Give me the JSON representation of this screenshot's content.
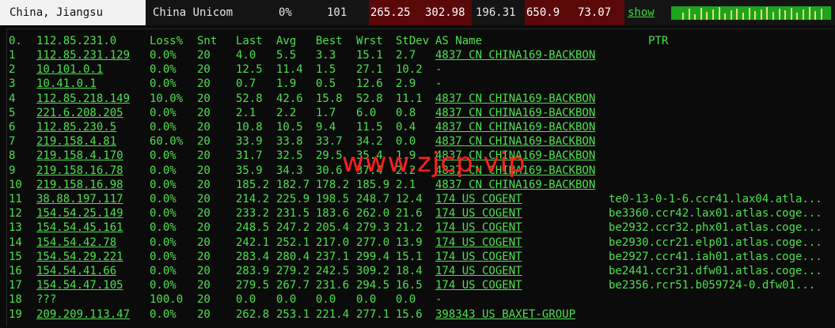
{
  "header": {
    "location": "China, Jiangsu",
    "isp": "China Unicom",
    "loss": "0%",
    "sent": "101",
    "last": "265.25",
    "avg": "302.98",
    "best": "196.31",
    "worst": "650.9",
    "stdev": "73.07",
    "show_label": "show",
    "colors": {
      "latency_bg": "#5a0808",
      "sparkline": "#1ea41e",
      "text": "#4ee04e"
    }
  },
  "columns": [
    "0.",
    "112.85.231.0",
    "Loss%",
    "Snt",
    "Last",
    "Avg",
    "Best",
    "Wrst",
    "StDev",
    "AS Name",
    "PTR"
  ],
  "hops": [
    {
      "n": "1",
      "host": "112.85.231.129",
      "loss": "0.0%",
      "snt": "20",
      "last": "4.0",
      "avg": "5.5",
      "best": "3.3",
      "wrst": "15.1",
      "stdev": "2.7",
      "as": "4837  CN CHINA169-BACKBON",
      "ptr": ""
    },
    {
      "n": "2",
      "host": "10.101.0.1",
      "loss": "0.0%",
      "snt": "20",
      "last": "12.5",
      "avg": "11.4",
      "best": "1.5",
      "wrst": "27.1",
      "stdev": "10.2",
      "as": "-",
      "ptr": ""
    },
    {
      "n": "3",
      "host": "10.41.0.1",
      "loss": "0.0%",
      "snt": "20",
      "last": "0.7",
      "avg": "1.9",
      "best": "0.5",
      "wrst": "12.6",
      "stdev": "2.9",
      "as": "-",
      "ptr": ""
    },
    {
      "n": "4",
      "host": "112.85.218.149",
      "loss": "10.0%",
      "snt": "20",
      "last": "52.8",
      "avg": "42.6",
      "best": "15.8",
      "wrst": "52.8",
      "stdev": "11.1",
      "as": "4837  CN CHINA169-BACKBON",
      "ptr": ""
    },
    {
      "n": "5",
      "host": "221.6.208.205",
      "loss": "0.0%",
      "snt": "20",
      "last": "2.1",
      "avg": "2.2",
      "best": "1.7",
      "wrst": "6.0",
      "stdev": "0.8",
      "as": "4837  CN CHINA169-BACKBON",
      "ptr": ""
    },
    {
      "n": "6",
      "host": "112.85.230.5",
      "loss": "0.0%",
      "snt": "20",
      "last": "10.8",
      "avg": "10.5",
      "best": "9.4",
      "wrst": "11.5",
      "stdev": "0.4",
      "as": "4837  CN CHINA169-BACKBON",
      "ptr": ""
    },
    {
      "n": "7",
      "host": "219.158.4.81",
      "loss": "60.0%",
      "snt": "20",
      "last": "33.9",
      "avg": "33.8",
      "best": "33.7",
      "wrst": "34.2",
      "stdev": "0.0",
      "as": "4837  CN CHINA169-BACKBON",
      "ptr": ""
    },
    {
      "n": "8",
      "host": "219.158.4.170",
      "loss": "0.0%",
      "snt": "20",
      "last": "31.7",
      "avg": "32.5",
      "best": "29.5",
      "wrst": "35.4",
      "stdev": "1.9",
      "as": "4837  CN CHINA169-BACKBON",
      "ptr": ""
    },
    {
      "n": "9",
      "host": "219.158.16.78",
      "loss": "0.0%",
      "snt": "20",
      "last": "35.9",
      "avg": "34.3",
      "best": "30.6",
      "wrst": "37.4",
      "stdev": "2.2",
      "as": "4837  CN CHINA169-BACKBON",
      "ptr": ""
    },
    {
      "n": "10",
      "host": "219.158.16.98",
      "loss": "0.0%",
      "snt": "20",
      "last": "185.2",
      "avg": "182.7",
      "best": "178.2",
      "wrst": "185.9",
      "stdev": "2.1",
      "as": "4837  CN CHINA169-BACKBON",
      "ptr": ""
    },
    {
      "n": "11",
      "host": "38.88.197.117",
      "loss": "0.0%",
      "snt": "20",
      "last": "214.2",
      "avg": "225.9",
      "best": "198.5",
      "wrst": "248.7",
      "stdev": "12.4",
      "as": "174   US COGENT",
      "ptr": "te0-13-0-1-6.ccr41.lax04.atla..."
    },
    {
      "n": "12",
      "host": "154.54.25.149",
      "loss": "0.0%",
      "snt": "20",
      "last": "233.2",
      "avg": "231.5",
      "best": "183.6",
      "wrst": "262.0",
      "stdev": "21.6",
      "as": "174   US COGENT",
      "ptr": "be3360.ccr42.lax01.atlas.coge..."
    },
    {
      "n": "13",
      "host": "154.54.45.161",
      "loss": "0.0%",
      "snt": "20",
      "last": "248.5",
      "avg": "247.2",
      "best": "205.4",
      "wrst": "279.3",
      "stdev": "21.2",
      "as": "174   US COGENT",
      "ptr": "be2932.ccr32.phx01.atlas.coge..."
    },
    {
      "n": "14",
      "host": "154.54.42.78",
      "loss": "0.0%",
      "snt": "20",
      "last": "242.1",
      "avg": "252.1",
      "best": "217.0",
      "wrst": "277.0",
      "stdev": "13.9",
      "as": "174   US COGENT",
      "ptr": "be2930.ccr21.elp01.atlas.coge..."
    },
    {
      "n": "15",
      "host": "154.54.29.221",
      "loss": "0.0%",
      "snt": "20",
      "last": "283.4",
      "avg": "280.4",
      "best": "237.1",
      "wrst": "299.4",
      "stdev": "15.1",
      "as": "174   US COGENT",
      "ptr": "be2927.ccr41.iah01.atlas.coge..."
    },
    {
      "n": "16",
      "host": "154.54.41.66",
      "loss": "0.0%",
      "snt": "20",
      "last": "283.9",
      "avg": "279.2",
      "best": "242.5",
      "wrst": "309.2",
      "stdev": "18.4",
      "as": "174   US COGENT",
      "ptr": "be2441.ccr31.dfw01.atlas.coge..."
    },
    {
      "n": "17",
      "host": "154.54.47.105",
      "loss": "0.0%",
      "snt": "20",
      "last": "279.5",
      "avg": "267.7",
      "best": "231.6",
      "wrst": "294.5",
      "stdev": "16.5",
      "as": "174   US COGENT",
      "ptr": "be2356.rcr51.b059724-0.dfw01..."
    },
    {
      "n": "18",
      "host": "???",
      "loss": "100.0",
      "snt": "20",
      "last": "0.0",
      "avg": "0.0",
      "best": "0.0",
      "wrst": "0.0",
      "stdev": "0.0",
      "as": "-",
      "ptr": ""
    },
    {
      "n": "19",
      "host": "209.209.113.47",
      "loss": "0.0%",
      "snt": "20",
      "last": "262.8",
      "avg": "253.1",
      "best": "221.4",
      "wrst": "277.1",
      "stdev": "15.6",
      "as": "398343 US BAXET-GROUP",
      "ptr": ""
    }
  ],
  "watermark": "www.zjcp.vip"
}
